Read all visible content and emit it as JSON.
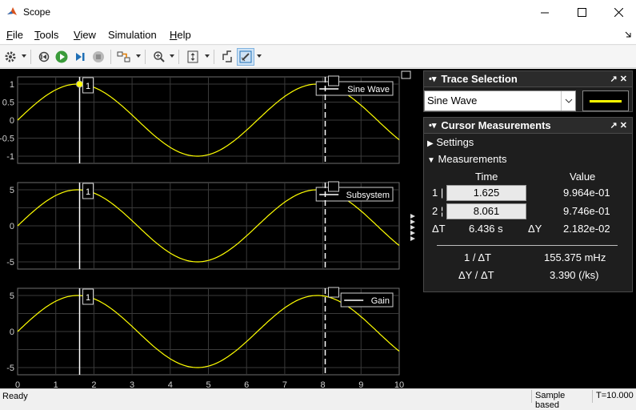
{
  "window": {
    "title": "Scope"
  },
  "menu": [
    {
      "label": "File",
      "accel": "F",
      "rest": "ile"
    },
    {
      "label": "Tools",
      "accel": "T",
      "rest": "ools"
    },
    {
      "label": "View",
      "accel": "V",
      "rest": "iew"
    },
    {
      "label": "Simulation",
      "accel": "",
      "rest": "Simulation"
    },
    {
      "label": "Help",
      "accel": "H",
      "rest": "elp"
    }
  ],
  "toolbar": {
    "icons": [
      "gear-icon",
      "step-back-icon",
      "run-icon",
      "step-forward-icon",
      "stop-icon",
      "highlight-icon",
      "zoom-icon",
      "autoscale-icon",
      "signal-select-icon",
      "cursor-measure-icon"
    ]
  },
  "plots": {
    "x_ticks": [
      "0",
      "1",
      "2",
      "3",
      "4",
      "5",
      "6",
      "7",
      "8",
      "9",
      "10"
    ],
    "cursor1_label": "1",
    "cursor2_label": "2",
    "axes": [
      {
        "legend": "Sine Wave",
        "y_ticks": [
          "1",
          "0.5",
          "0",
          "-0.5",
          "-1"
        ]
      },
      {
        "legend": "Subsystem",
        "y_ticks": [
          "5",
          "0",
          "-5"
        ]
      },
      {
        "legend": "Gain",
        "y_ticks": [
          "5",
          "0",
          "-5"
        ]
      }
    ]
  },
  "chart_data": [
    {
      "type": "line",
      "series": [
        {
          "name": "Sine Wave",
          "color": "#ffff00"
        }
      ],
      "x": [
        0,
        10
      ],
      "function": "sin(t)",
      "xlim": [
        0,
        10
      ],
      "ylim": [
        -1.2,
        1.2
      ]
    },
    {
      "type": "line",
      "series": [
        {
          "name": "Subsystem",
          "color": "#ffff00"
        }
      ],
      "x": [
        0,
        10
      ],
      "function": "5*sin(t)",
      "xlim": [
        0,
        10
      ],
      "ylim": [
        -6,
        6
      ]
    },
    {
      "type": "line",
      "series": [
        {
          "name": "Gain",
          "color": "#ffff00"
        }
      ],
      "x": [
        0,
        10
      ],
      "function": "5*sin(t)",
      "xlim": [
        0,
        10
      ],
      "ylim": [
        -6,
        6
      ]
    }
  ],
  "cursors": {
    "c1_time": 1.625,
    "c2_time": 8.061
  },
  "trace_selection": {
    "title": "Trace Selection",
    "selected": "Sine Wave",
    "line_color": "#ffff00"
  },
  "cursor_measurements": {
    "title": "Cursor Measurements",
    "settings_label": "Settings",
    "measurements_label": "Measurements",
    "col_time": "Time",
    "col_value": "Value",
    "row1_label": "1",
    "row2_label": "2",
    "t1": "1.625",
    "t2": "8.061",
    "v1": "9.964e-01",
    "v2": "9.746e-01",
    "dT_label": "ΔT",
    "dT": "6.436 s",
    "dY_label": "ΔY",
    "dY": "2.182e-02",
    "inv_dT_label": "1 / ΔT",
    "inv_dT": "155.375 mHz",
    "slope_label": "ΔY / ΔT",
    "slope": "3.390 (/ks)"
  },
  "status": {
    "left": "Ready",
    "mode": "Sample based",
    "time": "T=10.000"
  }
}
